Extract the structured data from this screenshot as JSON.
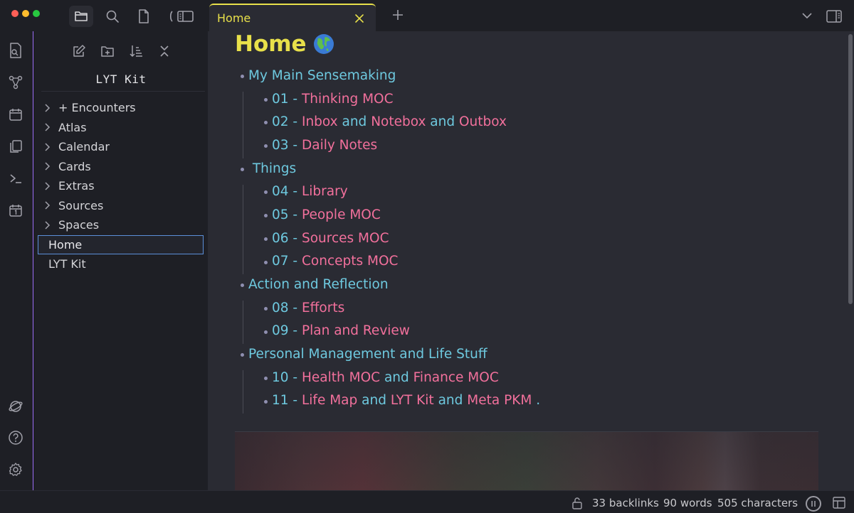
{
  "window": {
    "traffic_lights": [
      "close",
      "minimize",
      "maximize"
    ]
  },
  "sidebar_tabs": [
    {
      "name": "files-icon",
      "active": true
    },
    {
      "name": "search-icon",
      "active": false
    },
    {
      "name": "bookmarks-icon",
      "active": false
    },
    {
      "name": "collapse-sidebar-icon",
      "active": false
    }
  ],
  "ribbon": [
    "open-quick-switcher-icon",
    "graph-view-icon",
    "daily-notes-icon",
    "templates-icon",
    "command-palette-icon",
    "calendar-icon",
    "vault-switcher-icon",
    "help-icon",
    "settings-icon"
  ],
  "explorer": {
    "vault_name": "LYT Kit",
    "folders": [
      "+ Encounters",
      "Atlas",
      "Calendar",
      "Cards",
      "Extras",
      "Sources",
      "Spaces"
    ],
    "files": [
      "Home",
      "LYT Kit"
    ],
    "selected": "Home"
  },
  "tab": {
    "title": "Home"
  },
  "note": {
    "title": "Home",
    "outline": [
      {
        "level": 1,
        "parts": [
          {
            "t": "My Main Sensemaking",
            "c": "cyan"
          }
        ]
      },
      {
        "level": 2,
        "parts": [
          {
            "t": "01 - ",
            "c": "cyan"
          },
          {
            "t": "Thinking MOC",
            "c": "pink"
          }
        ]
      },
      {
        "level": 2,
        "parts": [
          {
            "t": "02 - ",
            "c": "cyan"
          },
          {
            "t": "Inbox",
            "c": "pink"
          },
          {
            "t": " and ",
            "c": "cyan"
          },
          {
            "t": "Notebox",
            "c": "pink"
          },
          {
            "t": " and ",
            "c": "cyan"
          },
          {
            "t": "Outbox",
            "c": "pink"
          }
        ]
      },
      {
        "level": 2,
        "parts": [
          {
            "t": "03 - ",
            "c": "cyan"
          },
          {
            "t": "Daily Notes",
            "c": "pink"
          }
        ]
      },
      {
        "level": 1,
        "parts": [
          {
            "t": " Things",
            "c": "cyan"
          }
        ]
      },
      {
        "level": 2,
        "parts": [
          {
            "t": "04 - ",
            "c": "cyan"
          },
          {
            "t": "Library",
            "c": "pink"
          }
        ]
      },
      {
        "level": 2,
        "parts": [
          {
            "t": "05 - ",
            "c": "cyan"
          },
          {
            "t": "People MOC",
            "c": "pink"
          }
        ]
      },
      {
        "level": 2,
        "parts": [
          {
            "t": "06 - ",
            "c": "cyan"
          },
          {
            "t": "Sources MOC",
            "c": "pink"
          }
        ]
      },
      {
        "level": 2,
        "parts": [
          {
            "t": "07 - ",
            "c": "cyan"
          },
          {
            "t": "Concepts MOC",
            "c": "pink"
          }
        ]
      },
      {
        "level": 1,
        "parts": [
          {
            "t": "Action and Reflection",
            "c": "cyan"
          }
        ]
      },
      {
        "level": 2,
        "parts": [
          {
            "t": "08 - ",
            "c": "cyan"
          },
          {
            "t": "Efforts",
            "c": "pink"
          }
        ]
      },
      {
        "level": 2,
        "parts": [
          {
            "t": "09 - ",
            "c": "cyan"
          },
          {
            "t": "Plan and Review",
            "c": "pink"
          }
        ]
      },
      {
        "level": 1,
        "parts": [
          {
            "t": "Personal Management and Life Stuff",
            "c": "cyan"
          }
        ]
      },
      {
        "level": 2,
        "parts": [
          {
            "t": "10 - ",
            "c": "cyan"
          },
          {
            "t": "Health MOC",
            "c": "pink"
          },
          {
            "t": " and ",
            "c": "cyan"
          },
          {
            "t": "Finance MOC",
            "c": "pink"
          }
        ]
      },
      {
        "level": 2,
        "parts": [
          {
            "t": "11 - ",
            "c": "cyan"
          },
          {
            "t": "Life Map",
            "c": "pink"
          },
          {
            "t": " and ",
            "c": "cyan"
          },
          {
            "t": "LYT Kit",
            "c": "pink"
          },
          {
            "t": " and ",
            "c": "cyan"
          },
          {
            "t": "Meta PKM",
            "c": "pink"
          },
          {
            "t": " .",
            "c": "cyan"
          }
        ]
      }
    ]
  },
  "status": {
    "backlinks": "33 backlinks",
    "words": "90 words",
    "characters": "505 characters"
  },
  "colors": {
    "accent_yellow": "#e8e04a",
    "link_pink": "#f2709c",
    "text_cyan": "#6ec9df",
    "ribbon_border": "#9b6cf6",
    "selected_border": "#5b8fd9"
  }
}
